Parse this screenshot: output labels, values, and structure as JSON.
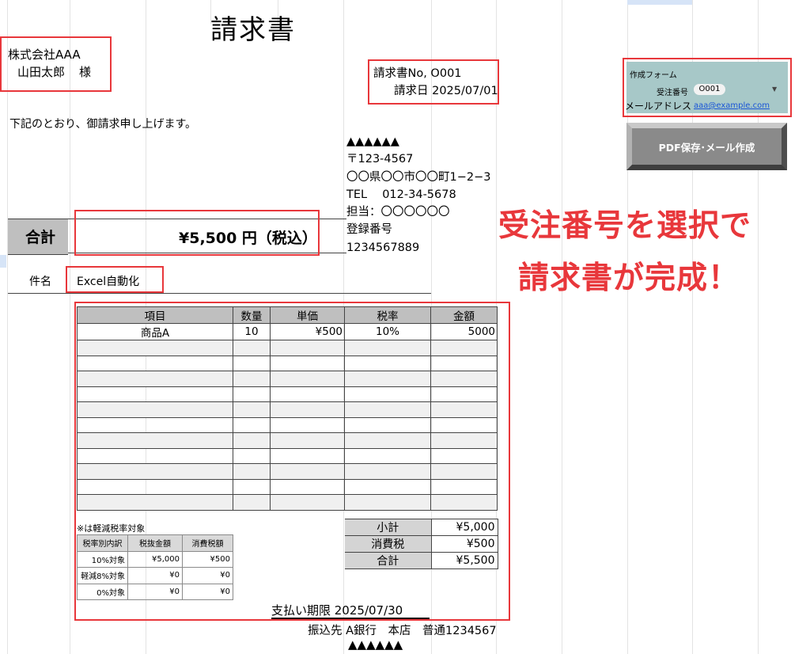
{
  "document": {
    "title": "請求書",
    "customer": {
      "company": "株式会社AAA",
      "person": "山田太郎",
      "honorific": "様"
    },
    "invoice_no": "請求書No, O001",
    "invoice_date": "請求日 2025/07/01",
    "intro": "下記のとおり、御請求申し上げます。",
    "sender": {
      "triangles": "▲▲▲▲▲▲",
      "postal": "〒123-4567",
      "address": "〇〇県〇〇市〇〇町1−2−3",
      "tel": "TEL　 012-34-5678",
      "contact": "担当：〇〇〇〇〇〇",
      "reg_label": "登録番号",
      "reg_number": "1234567889"
    },
    "total": {
      "label": "合計",
      "value": "¥5,500 円（税込）"
    },
    "subject": {
      "label": "件名",
      "value": "Excel自動化"
    },
    "items": {
      "headers": [
        "項目",
        "数量",
        "単価",
        "税率",
        "金額"
      ],
      "rows": [
        [
          "商品A",
          "10",
          "¥500",
          "10%",
          "5000"
        ]
      ]
    },
    "reduced_note": "※は軽減税率対象",
    "tax_breakdown": {
      "headers": [
        "税率別内訳",
        "税抜金額",
        "消費税額"
      ],
      "rows": [
        [
          "10%対象",
          "¥5,000",
          "¥500"
        ],
        [
          "軽減8%対象",
          "¥0",
          "¥0"
        ],
        [
          "0%対象",
          "¥0",
          "¥0"
        ]
      ]
    },
    "summary": [
      {
        "label": "小計",
        "value": "¥5,000"
      },
      {
        "label": "消費税",
        "value": "¥500"
      },
      {
        "label": "合計",
        "value": "¥5,500"
      }
    ],
    "due": "支払い期限 2025/07/30",
    "bank": "振込先 A銀行　本店　普通1234567",
    "triangles_bottom": "▲▲▲▲▲▲"
  },
  "form": {
    "title": "作成フォーム",
    "order_label": "受注番号",
    "order_value": "O001",
    "mail_label": "メールアドレス",
    "mail_value": "aaa@example.com",
    "button_label": "PDF保存･メール作成",
    "panel_color": "#a7c8c8"
  },
  "promo": {
    "line1": "受注番号を選択で",
    "line2": "請求書が完成！",
    "color": "#e8373b"
  },
  "icons": {
    "dropdown": "chevron-down-icon"
  }
}
